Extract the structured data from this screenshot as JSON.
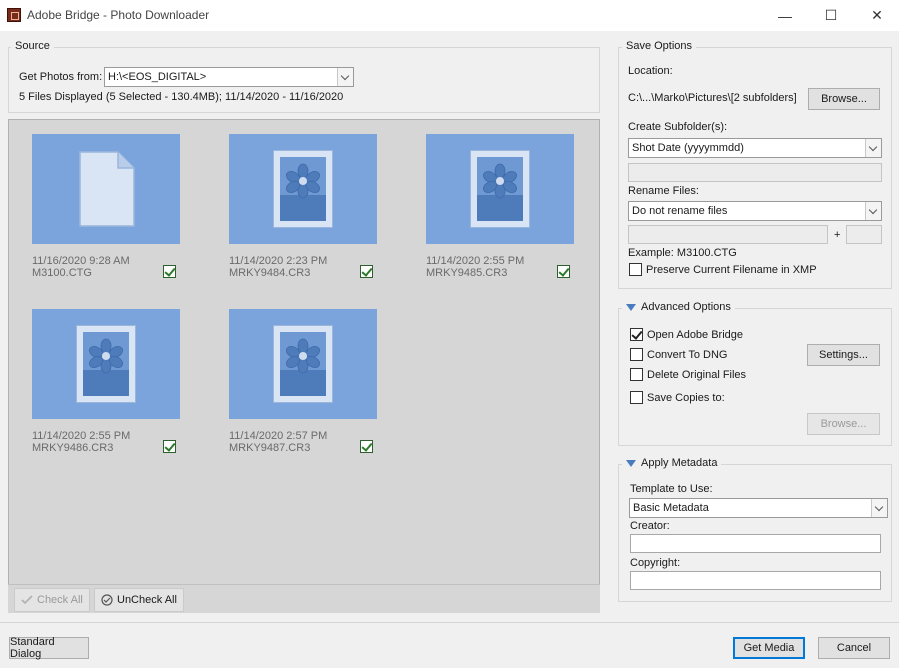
{
  "window": {
    "title": "Adobe Bridge - Photo Downloader",
    "minimize_glyph": "—",
    "maximize_glyph": "☐",
    "close_glyph": "✕"
  },
  "source": {
    "legend": "Source",
    "get_photos_label": "Get Photos from:",
    "get_photos_value": "H:\\<EOS_DIGITAL>",
    "summary": "5 Files Displayed (5 Selected - 130.4MB); 11/14/2020 - 11/16/2020"
  },
  "thumbnails": [
    {
      "date": "11/16/2020 9:28 AM",
      "name": "M3100.CTG",
      "checked": true,
      "icon": "document-icon"
    },
    {
      "date": "11/14/2020 2:23 PM",
      "name": "MRKY9484.CR3",
      "checked": true,
      "icon": "image-placeholder-icon"
    },
    {
      "date": "11/14/2020 2:55 PM",
      "name": "MRKY9485.CR3",
      "checked": true,
      "icon": "image-placeholder-icon"
    },
    {
      "date": "11/14/2020 2:55 PM",
      "name": "MRKY9486.CR3",
      "checked": true,
      "icon": "image-placeholder-icon"
    },
    {
      "date": "11/14/2020 2:57 PM",
      "name": "MRKY9487.CR3",
      "checked": true,
      "icon": "image-placeholder-icon"
    }
  ],
  "thumb_toolbar": {
    "check_all": "Check All",
    "uncheck_all": "UnCheck All"
  },
  "save_options": {
    "legend": "Save Options",
    "location_label": "Location:",
    "location_value": "C:\\...\\Marko\\Pictures\\[2 subfolders]",
    "browse": "Browse...",
    "create_subfolders_label": "Create Subfolder(s):",
    "create_subfolders_value": "Shot Date (yyyymmdd)",
    "rename_files_label": "Rename Files:",
    "rename_files_value": "Do not rename files",
    "plus": "+",
    "example": "Example:  M3100.CTG",
    "preserve_filename": "Preserve Current Filename in XMP",
    "preserve_checked": false
  },
  "advanced_options": {
    "legend": "Advanced Options",
    "open_bridge": "Open Adobe Bridge",
    "open_bridge_checked": true,
    "convert_dng": "Convert To DNG",
    "convert_dng_checked": false,
    "settings": "Settings...",
    "delete_originals": "Delete Original Files",
    "delete_originals_checked": false,
    "save_copies": "Save Copies to:",
    "save_copies_checked": false,
    "browse": "Browse..."
  },
  "apply_metadata": {
    "legend": "Apply Metadata",
    "template_label": "Template to Use:",
    "template_value": "Basic Metadata",
    "creator_label": "Creator:",
    "creator_value": "",
    "copyright_label": "Copyright:",
    "copyright_value": ""
  },
  "footer": {
    "standard_dialog": "Standard Dialog",
    "get_media": "Get Media",
    "cancel": "Cancel"
  },
  "colors": {
    "thumb_bg": "#7ca4dc",
    "thumb_area_bg": "#d6d6d6",
    "primary_border": "#0078d7",
    "check_green": "#2a7a2a"
  }
}
